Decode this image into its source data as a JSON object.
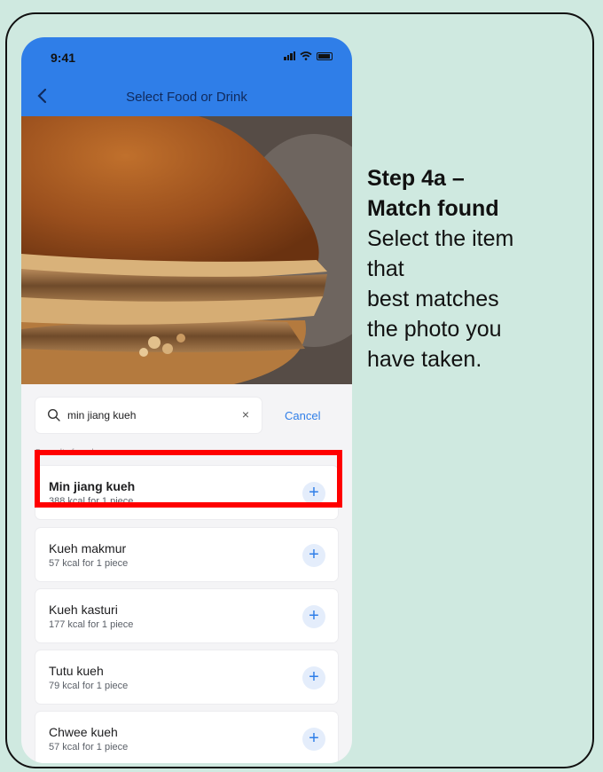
{
  "status_bar": {
    "time": "9:41"
  },
  "header": {
    "title": "Select Food or Drink"
  },
  "search": {
    "query": "min jiang kueh",
    "clear_icon": "×",
    "cancel_label": "Cancel"
  },
  "results_label": "5 results found",
  "results": [
    {
      "name": "Min jiang kueh",
      "kcal": "388 kcal for 1 piece"
    },
    {
      "name": "Kueh makmur",
      "kcal": "57 kcal for 1 piece"
    },
    {
      "name": "Kueh kasturi",
      "kcal": "177 kcal for 1 piece"
    },
    {
      "name": "Tutu kueh",
      "kcal": "79 kcal for 1 piece"
    },
    {
      "name": "Chwee kueh",
      "kcal": "57 kcal for 1 piece"
    }
  ],
  "caption": {
    "step": "Step 4a –\nMatch found",
    "description": "Select the item\nthat\nbest matches\nthe photo you\nhave taken."
  },
  "colors": {
    "background": "#cfe9e0",
    "header_blue": "#2f7ee8",
    "highlight_red": "#ff0000",
    "plus_blue": "#2f7ee8"
  }
}
